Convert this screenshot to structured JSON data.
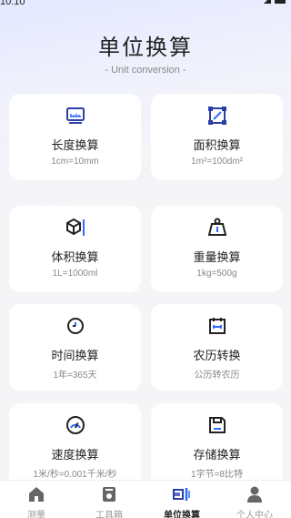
{
  "status": {
    "time": "10:10"
  },
  "header": {
    "title": "单位换算",
    "subtitle": "- Unit conversion -"
  },
  "cards": [
    {
      "name": "长度换算",
      "desc": "1cm=10mm",
      "icon": "ruler-monitor-icon"
    },
    {
      "name": "面积换算",
      "desc": "1m²=100dm²",
      "icon": "area-square-icon"
    },
    {
      "name": "体积换算",
      "desc": "1L=1000ml",
      "icon": "cube-icon"
    },
    {
      "name": "重量换算",
      "desc": "1kg=500g",
      "icon": "weight-icon"
    },
    {
      "name": "时间换算",
      "desc": "1年=365天",
      "icon": "clock-icon"
    },
    {
      "name": "农历转换",
      "desc": "公历转农历",
      "icon": "calendar-icon"
    },
    {
      "name": "速度换算",
      "desc": "1米/秒=0.001千米/秒",
      "icon": "speedometer-icon"
    },
    {
      "name": "存储换算",
      "desc": "1字节=8比特",
      "icon": "floppy-disk-icon"
    }
  ],
  "tabs": [
    {
      "label": "测量",
      "icon": "home-icon",
      "active": false
    },
    {
      "label": "工具箱",
      "icon": "toolbox-icon",
      "active": false
    },
    {
      "label": "单位换算",
      "icon": "unit-convert-icon",
      "active": true
    },
    {
      "label": "个人中心",
      "icon": "user-icon",
      "active": false
    }
  ],
  "colors": {
    "accent": "#2b3ea8",
    "icon_blue": "#2f6bff",
    "text": "#222222",
    "muted": "#888888"
  }
}
